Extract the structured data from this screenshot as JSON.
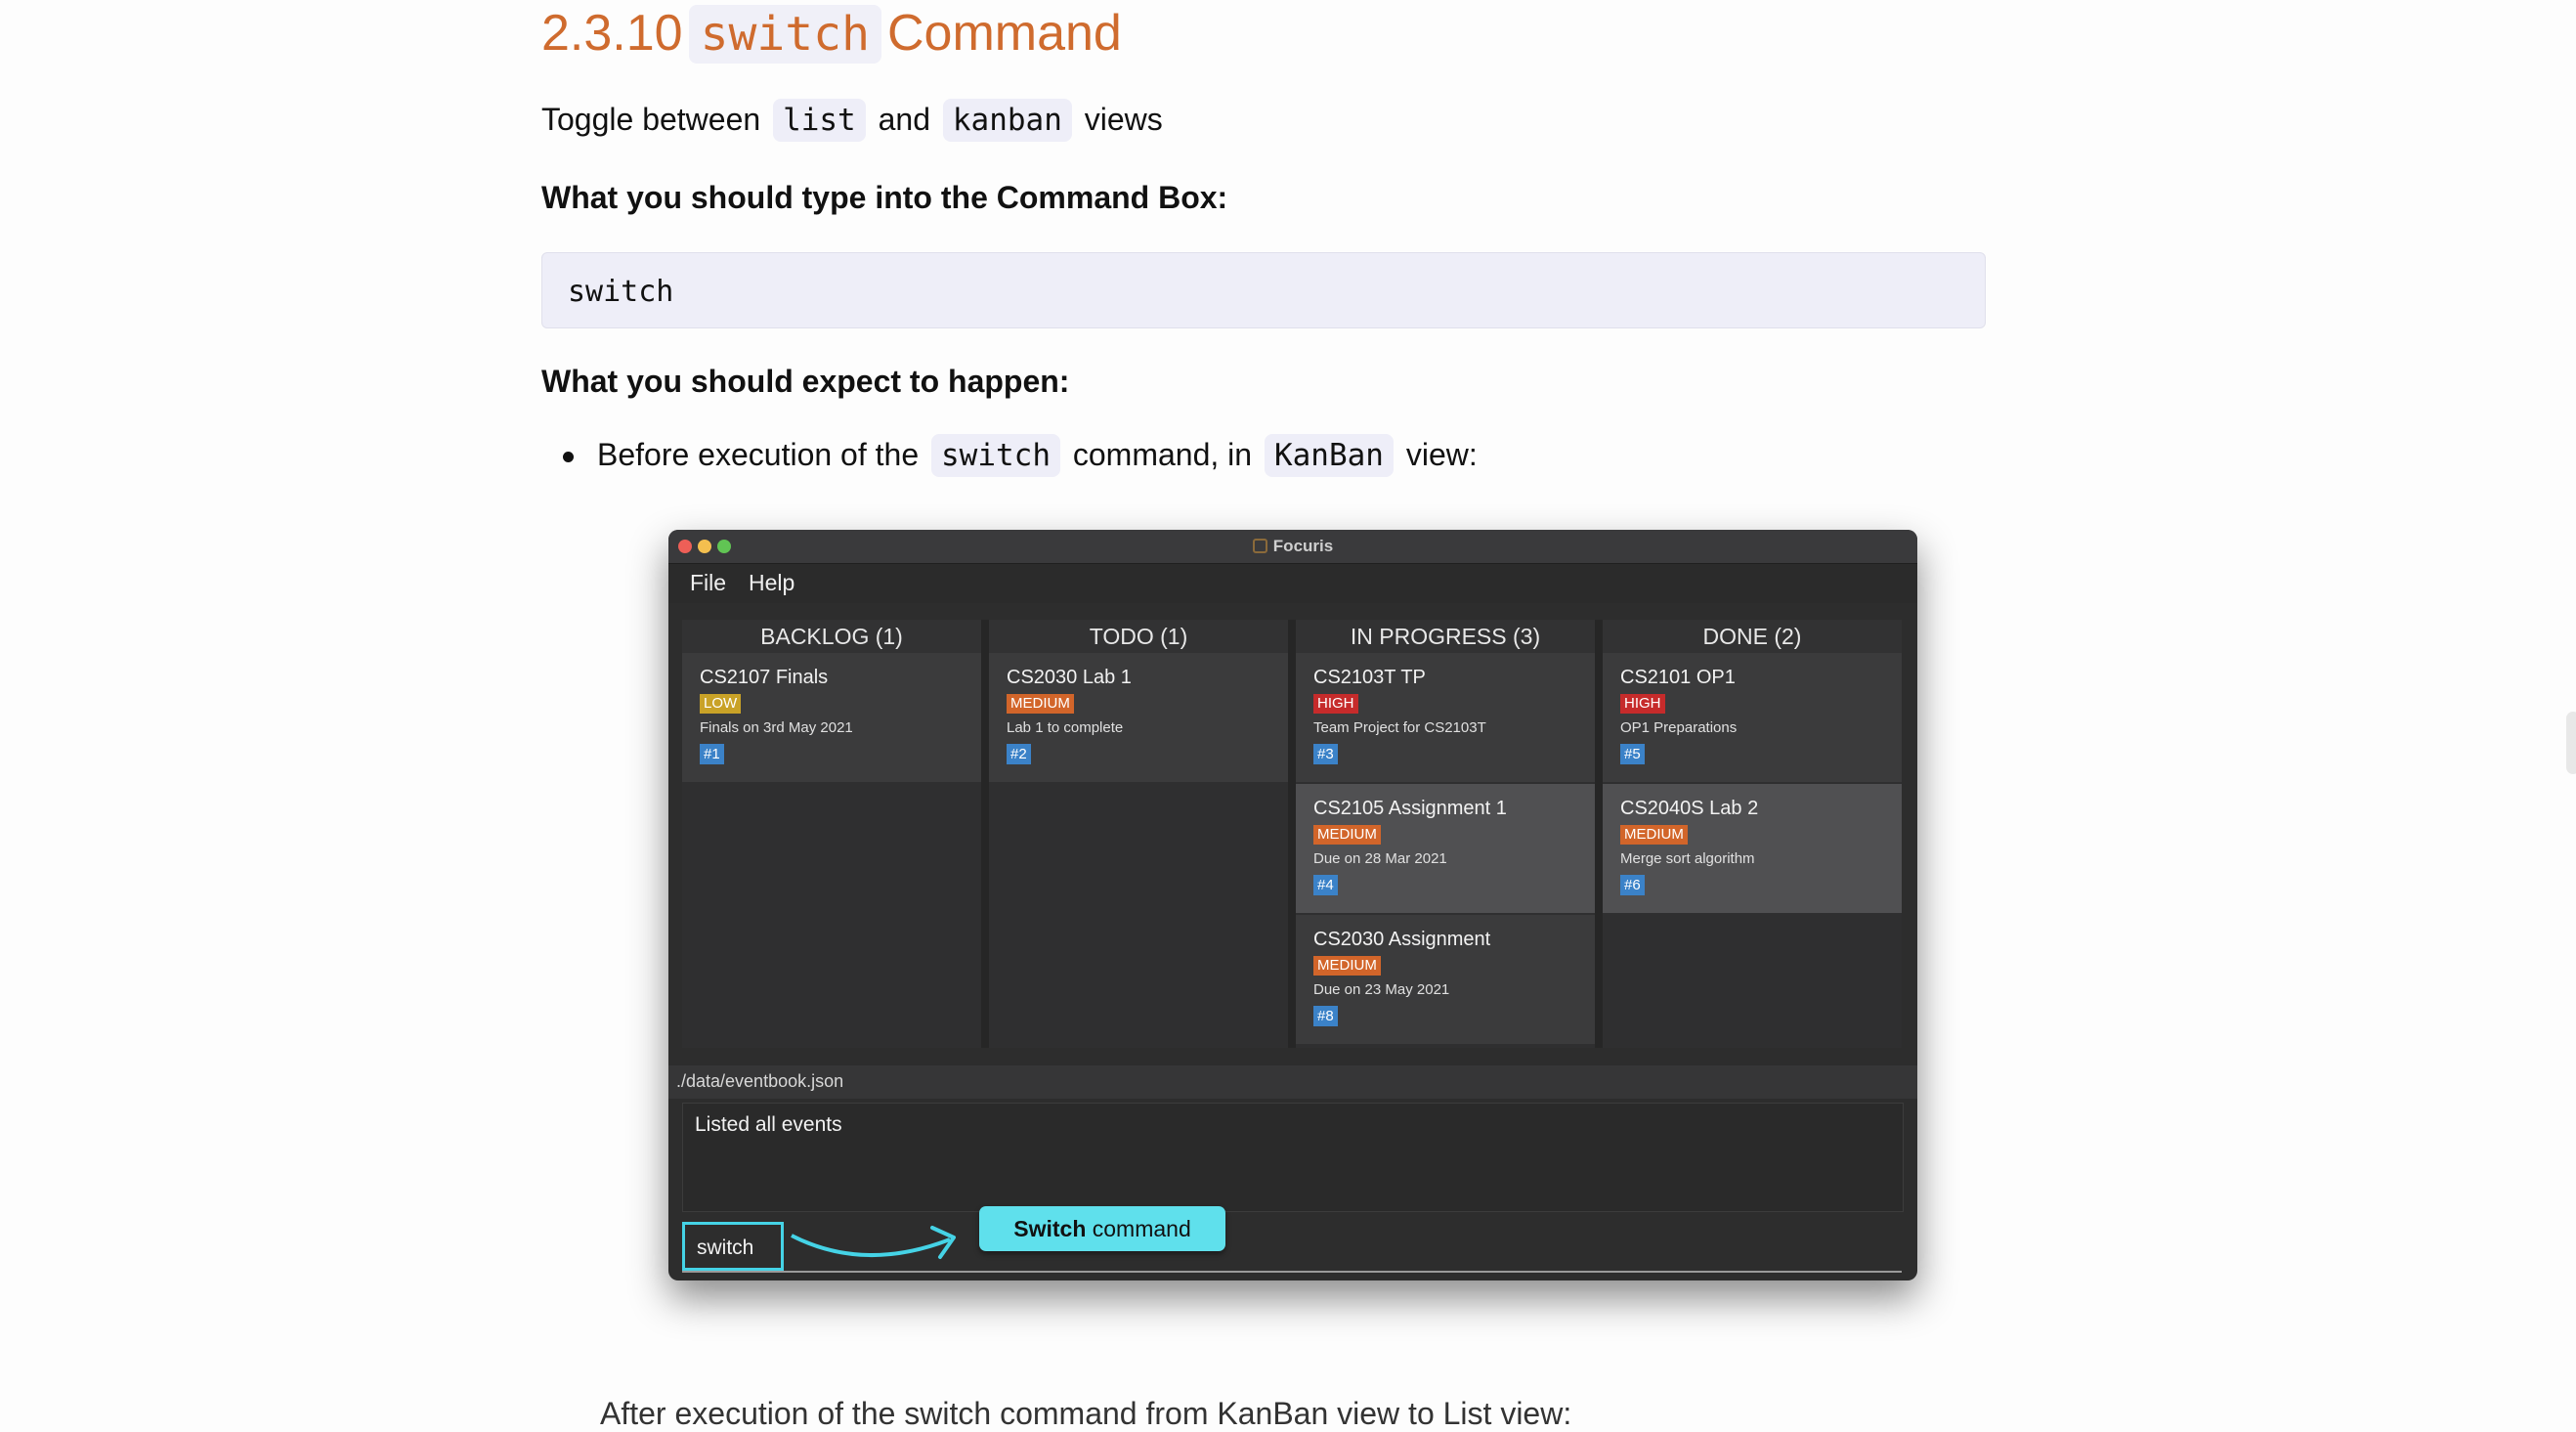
{
  "heading": {
    "number": "2.3.10",
    "code": "switch",
    "word": "Command"
  },
  "intro": {
    "before": "Toggle between",
    "code1": "list",
    "and": "and",
    "code2": "kanban",
    "after": "views"
  },
  "type_heading": "What you should type into the Command Box:",
  "command": "switch",
  "expect_heading": "What you should expect to happen:",
  "bullet": {
    "before": "Before execution of the",
    "code1": "switch",
    "middle": "command, in",
    "code2": "KanBan",
    "after": "view:"
  },
  "next_bullet_partial": "After execution of the switch command from KanBan view to List view:",
  "app": {
    "title": "Focuris",
    "menu": [
      "File",
      "Help"
    ],
    "columns": [
      {
        "header": "BACKLOG (1)",
        "cards": [
          {
            "title": "CS2107 Finals",
            "priority": "LOW",
            "desc": "Finals on 3rd May 2021",
            "id": "#1"
          }
        ]
      },
      {
        "header": "TODO (1)",
        "cards": [
          {
            "title": "CS2030 Lab 1",
            "priority": "MEDIUM",
            "desc": "Lab 1 to complete",
            "id": "#2"
          }
        ]
      },
      {
        "header": "IN PROGRESS (3)",
        "cards": [
          {
            "title": "CS2103T TP",
            "priority": "HIGH",
            "desc": "Team Project for CS2103T",
            "id": "#3"
          },
          {
            "title": "CS2105 Assignment 1",
            "priority": "MEDIUM",
            "desc": "Due on 28 Mar 2021",
            "id": "#4"
          },
          {
            "title": "CS2030 Assignment",
            "priority": "MEDIUM",
            "desc": "Due on 23 May 2021",
            "id": "#8"
          }
        ]
      },
      {
        "header": "DONE (2)",
        "cards": [
          {
            "title": "CS2101 OP1",
            "priority": "HIGH",
            "desc": "OP1 Preparations",
            "id": "#5"
          },
          {
            "title": "CS2040S Lab 2",
            "priority": "MEDIUM",
            "desc": "Merge sort algorithm",
            "id": "#6"
          }
        ]
      }
    ],
    "status_path": "./data/eventbook.json",
    "result_text": "Listed all events",
    "command_input": "switch",
    "callout": {
      "bold": "Switch",
      "rest": "command"
    },
    "priority_colors": {
      "LOW": "#c9a227",
      "MEDIUM": "#d2652a",
      "HIGH": "#c62b2b"
    }
  },
  "colors": {
    "heading": "#cf6b2e",
    "code_bg": "#eeeef8",
    "callout": "#5fe0ec"
  }
}
